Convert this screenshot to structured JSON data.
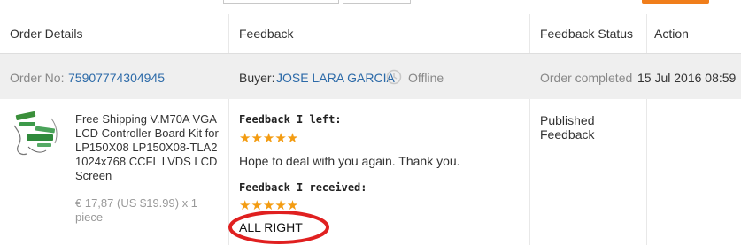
{
  "header": {
    "col_order_details": "Order Details",
    "col_feedback": "Feedback",
    "col_feedback_status": "Feedback Status",
    "col_action": "Action"
  },
  "order": {
    "order_no_label": "Order No:",
    "order_no": "75907774304945",
    "buyer_label": "Buyer:",
    "buyer_name": "JOSE LARA GARCIA",
    "buyer_status": "Offline",
    "completed_label": "Order completed",
    "completed_date": "15 Jul 2016 08:59"
  },
  "product": {
    "title": "Free Shipping V.M70A VGA LCD Controller Board Kit for LP150X08 LP150X08-TLA2 1024x768 CCFL LVDS LCD Screen",
    "price": "€ 17,87 (US $19.99) x 1 piece"
  },
  "feedback": {
    "left_label": "Feedback I left:",
    "left_stars": 5,
    "left_stars_text": "★★★★★",
    "left_comment": "Hope to deal with you again. Thank you.",
    "received_label": "Feedback I received:",
    "received_stars": 5,
    "received_stars_text": "★★★★★",
    "received_comment": "ALL RIGHT"
  },
  "feedback_status": {
    "line1": "Published",
    "line2": "Feedback"
  },
  "colors": {
    "link": "#2c6aa8",
    "star": "#f39c12",
    "annotation_circle": "#e02020",
    "accent_button": "#f07e1b"
  },
  "icons": [
    "clock-icon",
    "product-thumbnail",
    "star-icon"
  ]
}
